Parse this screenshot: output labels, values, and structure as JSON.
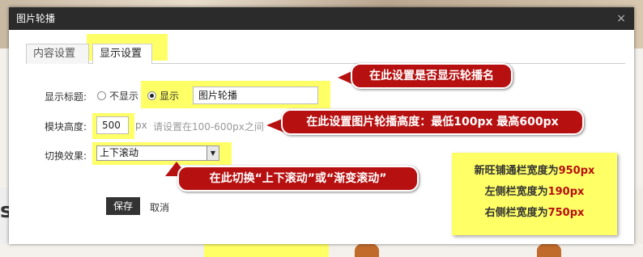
{
  "dialog": {
    "title": "图片轮播",
    "close_glyph": "×"
  },
  "tabs": [
    {
      "label": "内容设置",
      "active": false
    },
    {
      "label": "显示设置",
      "active": true
    }
  ],
  "form": {
    "title_label": "显示标题:",
    "hide_option": "不显示",
    "show_option": "显示",
    "selected_option": "显示",
    "title_value": "图片轮播",
    "height_label": "模块高度:",
    "height_value": "500",
    "height_unit": "px",
    "height_hint": "请设置在100-600px之间",
    "effect_label": "切换效果:",
    "effect_value": "上下滚动"
  },
  "buttons": {
    "save": "保存",
    "cancel": "取消"
  },
  "callouts": {
    "title": "在此设置是否显示轮播名",
    "height": "在此设置图片轮播高度：最低100px 最高600px",
    "effect": "在此切换“上下滚动”或“渐变滚动”"
  },
  "note": {
    "line1_text": "新旺铺通栏宽度为",
    "line1_num": "950px",
    "line2_text": "左侧栏宽度为",
    "line2_num": "190px",
    "line3_text": "右侧栏宽度为",
    "line3_num": "750px"
  },
  "background": {
    "partial_letter": "s"
  },
  "colors": {
    "highlight": "#ffff66",
    "callout": "#b71010",
    "titlebar": "#2b2b2b"
  }
}
